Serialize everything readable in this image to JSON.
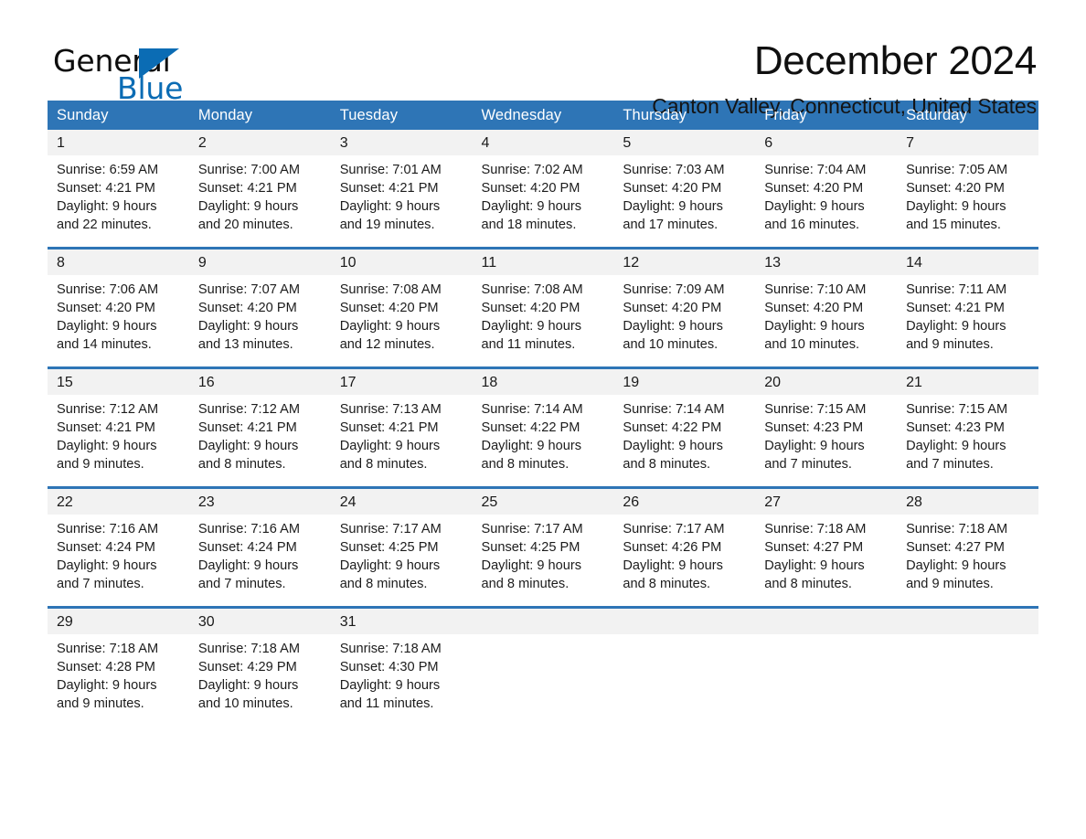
{
  "brand": {
    "name_part1": "General",
    "name_part2": "Blue",
    "logo_icon": "triangle-logo-icon",
    "accent_color": "#0b6cb4"
  },
  "header": {
    "title": "December 2024",
    "subtitle": "Canton Valley, Connecticut, United States",
    "header_bar_color": "#2e75b6",
    "daynum_band_color": "#f2f2f2"
  },
  "calendar": {
    "weekday_headers": [
      "Sunday",
      "Monday",
      "Tuesday",
      "Wednesday",
      "Thursday",
      "Friday",
      "Saturday"
    ],
    "weeks": [
      [
        {
          "day": "1",
          "sunrise": "Sunrise: 6:59 AM",
          "sunset": "Sunset: 4:21 PM",
          "daylight1": "Daylight: 9 hours",
          "daylight2": "and 22 minutes."
        },
        {
          "day": "2",
          "sunrise": "Sunrise: 7:00 AM",
          "sunset": "Sunset: 4:21 PM",
          "daylight1": "Daylight: 9 hours",
          "daylight2": "and 20 minutes."
        },
        {
          "day": "3",
          "sunrise": "Sunrise: 7:01 AM",
          "sunset": "Sunset: 4:21 PM",
          "daylight1": "Daylight: 9 hours",
          "daylight2": "and 19 minutes."
        },
        {
          "day": "4",
          "sunrise": "Sunrise: 7:02 AM",
          "sunset": "Sunset: 4:20 PM",
          "daylight1": "Daylight: 9 hours",
          "daylight2": "and 18 minutes."
        },
        {
          "day": "5",
          "sunrise": "Sunrise: 7:03 AM",
          "sunset": "Sunset: 4:20 PM",
          "daylight1": "Daylight: 9 hours",
          "daylight2": "and 17 minutes."
        },
        {
          "day": "6",
          "sunrise": "Sunrise: 7:04 AM",
          "sunset": "Sunset: 4:20 PM",
          "daylight1": "Daylight: 9 hours",
          "daylight2": "and 16 minutes."
        },
        {
          "day": "7",
          "sunrise": "Sunrise: 7:05 AM",
          "sunset": "Sunset: 4:20 PM",
          "daylight1": "Daylight: 9 hours",
          "daylight2": "and 15 minutes."
        }
      ],
      [
        {
          "day": "8",
          "sunrise": "Sunrise: 7:06 AM",
          "sunset": "Sunset: 4:20 PM",
          "daylight1": "Daylight: 9 hours",
          "daylight2": "and 14 minutes."
        },
        {
          "day": "9",
          "sunrise": "Sunrise: 7:07 AM",
          "sunset": "Sunset: 4:20 PM",
          "daylight1": "Daylight: 9 hours",
          "daylight2": "and 13 minutes."
        },
        {
          "day": "10",
          "sunrise": "Sunrise: 7:08 AM",
          "sunset": "Sunset: 4:20 PM",
          "daylight1": "Daylight: 9 hours",
          "daylight2": "and 12 minutes."
        },
        {
          "day": "11",
          "sunrise": "Sunrise: 7:08 AM",
          "sunset": "Sunset: 4:20 PM",
          "daylight1": "Daylight: 9 hours",
          "daylight2": "and 11 minutes."
        },
        {
          "day": "12",
          "sunrise": "Sunrise: 7:09 AM",
          "sunset": "Sunset: 4:20 PM",
          "daylight1": "Daylight: 9 hours",
          "daylight2": "and 10 minutes."
        },
        {
          "day": "13",
          "sunrise": "Sunrise: 7:10 AM",
          "sunset": "Sunset: 4:20 PM",
          "daylight1": "Daylight: 9 hours",
          "daylight2": "and 10 minutes."
        },
        {
          "day": "14",
          "sunrise": "Sunrise: 7:11 AM",
          "sunset": "Sunset: 4:21 PM",
          "daylight1": "Daylight: 9 hours",
          "daylight2": "and 9 minutes."
        }
      ],
      [
        {
          "day": "15",
          "sunrise": "Sunrise: 7:12 AM",
          "sunset": "Sunset: 4:21 PM",
          "daylight1": "Daylight: 9 hours",
          "daylight2": "and 9 minutes."
        },
        {
          "day": "16",
          "sunrise": "Sunrise: 7:12 AM",
          "sunset": "Sunset: 4:21 PM",
          "daylight1": "Daylight: 9 hours",
          "daylight2": "and 8 minutes."
        },
        {
          "day": "17",
          "sunrise": "Sunrise: 7:13 AM",
          "sunset": "Sunset: 4:21 PM",
          "daylight1": "Daylight: 9 hours",
          "daylight2": "and 8 minutes."
        },
        {
          "day": "18",
          "sunrise": "Sunrise: 7:14 AM",
          "sunset": "Sunset: 4:22 PM",
          "daylight1": "Daylight: 9 hours",
          "daylight2": "and 8 minutes."
        },
        {
          "day": "19",
          "sunrise": "Sunrise: 7:14 AM",
          "sunset": "Sunset: 4:22 PM",
          "daylight1": "Daylight: 9 hours",
          "daylight2": "and 8 minutes."
        },
        {
          "day": "20",
          "sunrise": "Sunrise: 7:15 AM",
          "sunset": "Sunset: 4:23 PM",
          "daylight1": "Daylight: 9 hours",
          "daylight2": "and 7 minutes."
        },
        {
          "day": "21",
          "sunrise": "Sunrise: 7:15 AM",
          "sunset": "Sunset: 4:23 PM",
          "daylight1": "Daylight: 9 hours",
          "daylight2": "and 7 minutes."
        }
      ],
      [
        {
          "day": "22",
          "sunrise": "Sunrise: 7:16 AM",
          "sunset": "Sunset: 4:24 PM",
          "daylight1": "Daylight: 9 hours",
          "daylight2": "and 7 minutes."
        },
        {
          "day": "23",
          "sunrise": "Sunrise: 7:16 AM",
          "sunset": "Sunset: 4:24 PM",
          "daylight1": "Daylight: 9 hours",
          "daylight2": "and 7 minutes."
        },
        {
          "day": "24",
          "sunrise": "Sunrise: 7:17 AM",
          "sunset": "Sunset: 4:25 PM",
          "daylight1": "Daylight: 9 hours",
          "daylight2": "and 8 minutes."
        },
        {
          "day": "25",
          "sunrise": "Sunrise: 7:17 AM",
          "sunset": "Sunset: 4:25 PM",
          "daylight1": "Daylight: 9 hours",
          "daylight2": "and 8 minutes."
        },
        {
          "day": "26",
          "sunrise": "Sunrise: 7:17 AM",
          "sunset": "Sunset: 4:26 PM",
          "daylight1": "Daylight: 9 hours",
          "daylight2": "and 8 minutes."
        },
        {
          "day": "27",
          "sunrise": "Sunrise: 7:18 AM",
          "sunset": "Sunset: 4:27 PM",
          "daylight1": "Daylight: 9 hours",
          "daylight2": "and 8 minutes."
        },
        {
          "day": "28",
          "sunrise": "Sunrise: 7:18 AM",
          "sunset": "Sunset: 4:27 PM",
          "daylight1": "Daylight: 9 hours",
          "daylight2": "and 9 minutes."
        }
      ],
      [
        {
          "day": "29",
          "sunrise": "Sunrise: 7:18 AM",
          "sunset": "Sunset: 4:28 PM",
          "daylight1": "Daylight: 9 hours",
          "daylight2": "and 9 minutes."
        },
        {
          "day": "30",
          "sunrise": "Sunrise: 7:18 AM",
          "sunset": "Sunset: 4:29 PM",
          "daylight1": "Daylight: 9 hours",
          "daylight2": "and 10 minutes."
        },
        {
          "day": "31",
          "sunrise": "Sunrise: 7:18 AM",
          "sunset": "Sunset: 4:30 PM",
          "daylight1": "Daylight: 9 hours",
          "daylight2": "and 11 minutes."
        },
        {
          "day": "",
          "sunrise": "",
          "sunset": "",
          "daylight1": "",
          "daylight2": ""
        },
        {
          "day": "",
          "sunrise": "",
          "sunset": "",
          "daylight1": "",
          "daylight2": ""
        },
        {
          "day": "",
          "sunrise": "",
          "sunset": "",
          "daylight1": "",
          "daylight2": ""
        },
        {
          "day": "",
          "sunrise": "",
          "sunset": "",
          "daylight1": "",
          "daylight2": ""
        }
      ]
    ]
  }
}
